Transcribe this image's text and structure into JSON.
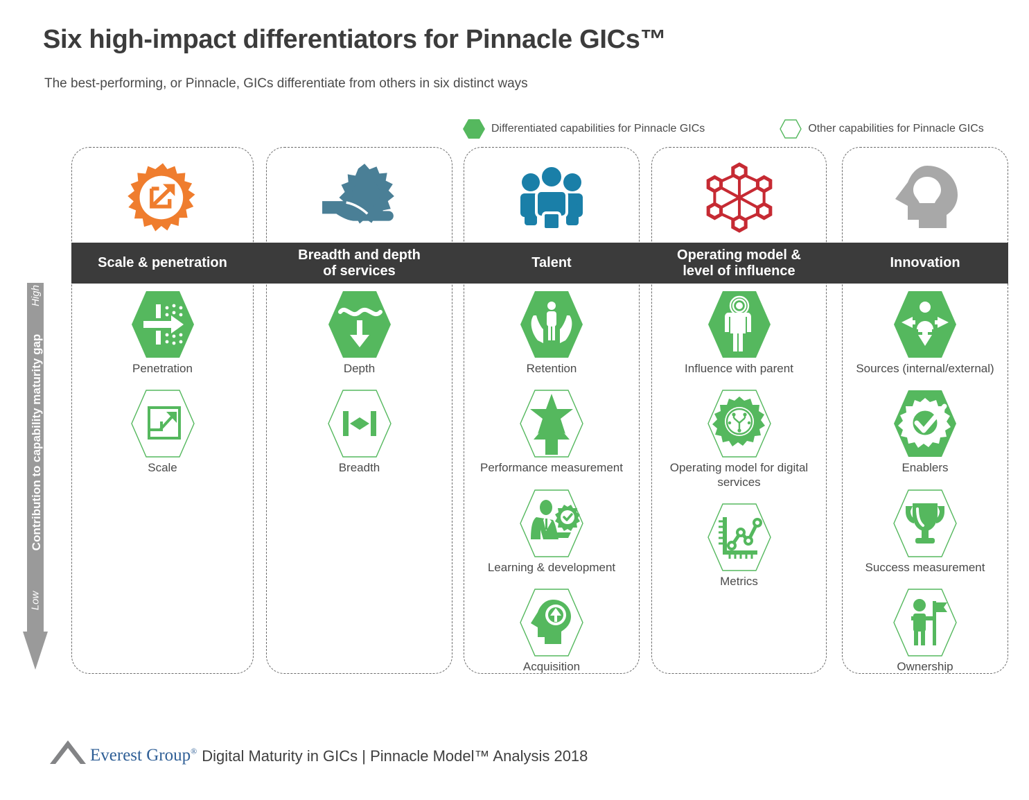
{
  "header": {
    "title": "Six high-impact differentiators for Pinnacle GICs™",
    "subtitle": "The best-performing, or Pinnacle, GICs differentiate from others in six distinct ways"
  },
  "legend": {
    "differentiated_label": "Differentiated capabilities for Pinnacle GICs",
    "other_label": "Other capabilities for Pinnacle GICs"
  },
  "axis": {
    "high_label": "High",
    "low_label": "Low",
    "main_label": "Contribution to capability maturity gap"
  },
  "colors": {
    "green": "#55b85e",
    "green_outline": "#55b85e",
    "band": "#3b3b3b",
    "axis_gray": "#9a9a9a",
    "orange": "#ef7d2e",
    "teal": "#4a7f96",
    "blue": "#1a7fa8",
    "red": "#c62a33",
    "gray_icon": "#a8a8a8",
    "logo_blue": "#2f5f96",
    "text": "#4a4a4a"
  },
  "columns": [
    {
      "header": "Scale & penetration",
      "icon": "gear-expand-icon",
      "icon_color": "#ef7d2e",
      "capabilities": [
        {
          "label": "Penetration",
          "type": "differentiated",
          "icon": "arrow-through-barrier-icon"
        },
        {
          "label": "Scale",
          "type": "other",
          "icon": "growth-chart-icon"
        }
      ]
    },
    {
      "header": "Breadth and depth of services",
      "header_lines": [
        "Breadth and depth",
        "of services"
      ],
      "icon": "hand-holding-gear-icon",
      "icon_color": "#4a7f96",
      "capabilities": [
        {
          "label": "Depth",
          "type": "differentiated",
          "icon": "wave-down-arrow-icon"
        },
        {
          "label": "Breadth",
          "type": "other",
          "icon": "horizontal-span-arrow-icon"
        }
      ]
    },
    {
      "header": "Talent",
      "icon": "people-group-icon",
      "icon_color": "#1a7fa8",
      "capabilities": [
        {
          "label": "Retention",
          "type": "differentiated",
          "icon": "hands-holding-person-icon"
        },
        {
          "label": "Performance measurement",
          "type": "other",
          "icon": "star-up-arrow-icon"
        },
        {
          "label": "Learning & development",
          "type": "other",
          "icon": "person-gear-check-icon"
        },
        {
          "label": "Acquisition",
          "type": "other",
          "icon": "head-up-arrow-icon"
        }
      ]
    },
    {
      "header": "Operating model & level of influence",
      "header_lines": [
        "Operating model &",
        "level of influence"
      ],
      "icon": "hexagon-network-icon",
      "icon_color": "#c62a33",
      "capabilities": [
        {
          "label": "Influence with parent",
          "type": "differentiated",
          "icon": "person-signal-icon"
        },
        {
          "label": "Operating model for digital services",
          "type": "other",
          "icon": "gear-circuit-icon"
        },
        {
          "label": "Metrics",
          "type": "other",
          "icon": "line-chart-icon"
        }
      ]
    },
    {
      "header": "Innovation",
      "icon": "head-lightbulb-icon",
      "icon_color": "#a8a8a8",
      "capabilities": [
        {
          "label": "Sources (internal/external)",
          "type": "differentiated",
          "icon": "person-four-arrows-icon"
        },
        {
          "label": "Enablers",
          "type": "differentiated",
          "icon": "gear-check-icon"
        },
        {
          "label": "Success measurement",
          "type": "other",
          "icon": "trophy-icon"
        },
        {
          "label": "Ownership",
          "type": "other",
          "icon": "person-flag-icon"
        }
      ]
    }
  ],
  "footer": {
    "logo_name": "Everest Group",
    "logo_registered": "®",
    "text": "Digital Maturity in GICs | Pinnacle Model™ Analysis 2018"
  }
}
